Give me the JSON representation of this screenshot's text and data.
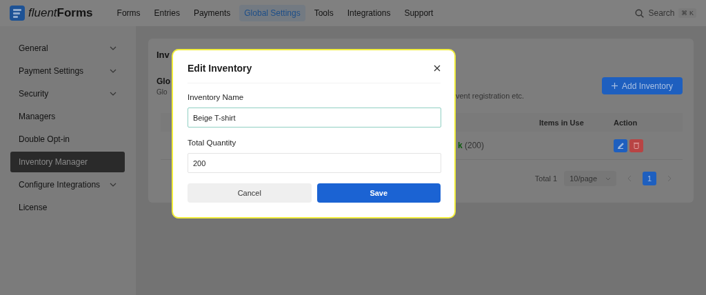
{
  "brand": {
    "name_light": "fluent",
    "name_bold": "Forms"
  },
  "nav": [
    {
      "label": "Forms",
      "selected": false
    },
    {
      "label": "Entries",
      "selected": false
    },
    {
      "label": "Payments",
      "selected": false
    },
    {
      "label": "Global Settings",
      "selected": true
    },
    {
      "label": "Tools",
      "selected": false
    },
    {
      "label": "Integrations",
      "selected": false
    },
    {
      "label": "Support",
      "selected": false
    }
  ],
  "search": {
    "label": "Search",
    "shortcut": "⌘ K"
  },
  "sidebar": {
    "items": [
      {
        "label": "General",
        "has_submenu": true,
        "selected": false
      },
      {
        "label": "Payment Settings",
        "has_submenu": true,
        "selected": false
      },
      {
        "label": "Security",
        "has_submenu": true,
        "selected": false
      },
      {
        "label": "Managers",
        "has_submenu": false,
        "selected": false
      },
      {
        "label": "Double Opt-in",
        "has_submenu": false,
        "selected": false
      },
      {
        "label": "Inventory Manager",
        "has_submenu": false,
        "selected": true
      },
      {
        "label": "Configure Integrations",
        "has_submenu": true,
        "selected": false
      },
      {
        "label": "License",
        "has_submenu": false,
        "selected": false
      }
    ]
  },
  "panel": {
    "title": "Inv",
    "section_title": "Glo",
    "description_start": "Glo",
    "description_end": "vent registration etc.",
    "add_button": "Add Inventory"
  },
  "table": {
    "columns": [
      "Items in Use",
      "Action"
    ],
    "rows": [
      {
        "stock_mark": "k",
        "quantity": "(200)"
      }
    ]
  },
  "pagination": {
    "total": "Total 1",
    "page_size": "10/page",
    "pages": [
      {
        "label": "1",
        "selected": true
      }
    ]
  },
  "modal": {
    "title": "Edit Inventory",
    "fields": [
      {
        "label": "Inventory Name",
        "value": "Beige T-shirt",
        "focused": true
      },
      {
        "label": "Total Quantity",
        "value": "200",
        "focused": false
      }
    ],
    "buttons": [
      {
        "label": "Cancel",
        "kind": "secondary"
      },
      {
        "label": "Save",
        "kind": "primary"
      }
    ]
  }
}
